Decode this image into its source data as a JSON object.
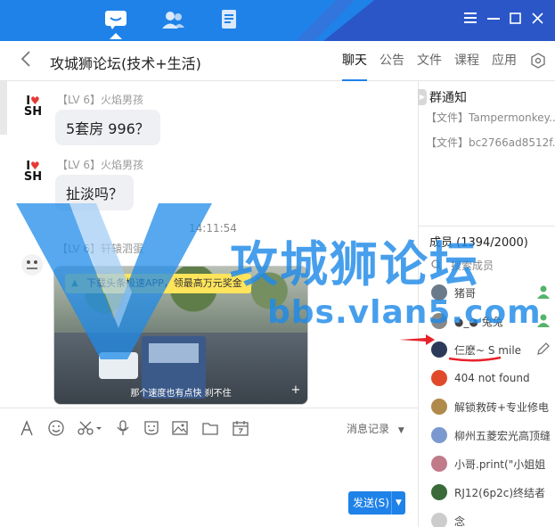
{
  "topbar": {
    "tabs": [
      {
        "name": "chat-tab-icon",
        "active": true
      },
      {
        "name": "contacts-tab-icon",
        "active": false
      },
      {
        "name": "files-tab-icon",
        "active": false
      }
    ],
    "window_controls": [
      "menu",
      "minimize",
      "maximize",
      "close"
    ],
    "colors": {
      "bar": "#1f82e8",
      "accent": "#2a56c8"
    }
  },
  "header": {
    "title": "攻城狮论坛(技术+生活)",
    "tabs": [
      {
        "label": "聊天",
        "active": true
      },
      {
        "label": "公告",
        "active": false
      },
      {
        "label": "文件",
        "active": false
      },
      {
        "label": "课程",
        "active": false
      },
      {
        "label": "应用",
        "active": false
      }
    ]
  },
  "messages": [
    {
      "avatar_text": "I ♥ SH",
      "sender": "【LV 6】火焰男孩",
      "text": "5套房 996？"
    },
    {
      "avatar_text": "I ♥ SH",
      "sender": "【LV 6】火焰男孩",
      "text": "扯淡吗？"
    }
  ],
  "time_divider": "14:11:54",
  "video_message": {
    "sender": "【LV 6】轩辕泗蛋",
    "ad_text": "下载头条极速APP，领最高万元奖金",
    "subtitle": "那个速度也有点快 刹不住"
  },
  "toolbar": {
    "history_label": "消息记录",
    "send_label": "发送(S)"
  },
  "group_notice": {
    "title": "群通知",
    "items": [
      "【文件】Tampermonkey...",
      "【文件】bc2766ad8512f..."
    ]
  },
  "members": {
    "title": "成员 (1394/2000)",
    "search_placeholder": "搜索成员",
    "list": [
      {
        "name": "猪哥",
        "avatar_color": "#6a7a8a"
      },
      {
        "name": "◕_◕ 兔兔",
        "avatar_color": "#888888"
      },
      {
        "name": "仨麽~ S mile",
        "avatar_color": "#2c3a5a"
      },
      {
        "name": "404 not found",
        "avatar_color": "#e04a2a"
      },
      {
        "name": "解锁救砖+专业修电",
        "avatar_color": "#b08a4a"
      },
      {
        "name": "柳州五菱宏光高顶缝",
        "avatar_color": "#7a9acf"
      },
      {
        "name": "小哥.print(\"小姐姐",
        "avatar_color": "#c07a8a"
      },
      {
        "name": "RJ12(6p2c)终结者",
        "avatar_color": "#3a6a3a"
      },
      {
        "name": "念",
        "avatar_color": "#cccccc"
      }
    ]
  },
  "watermark": {
    "text": "攻城狮论坛",
    "url": "bbs.vlan5.com"
  }
}
